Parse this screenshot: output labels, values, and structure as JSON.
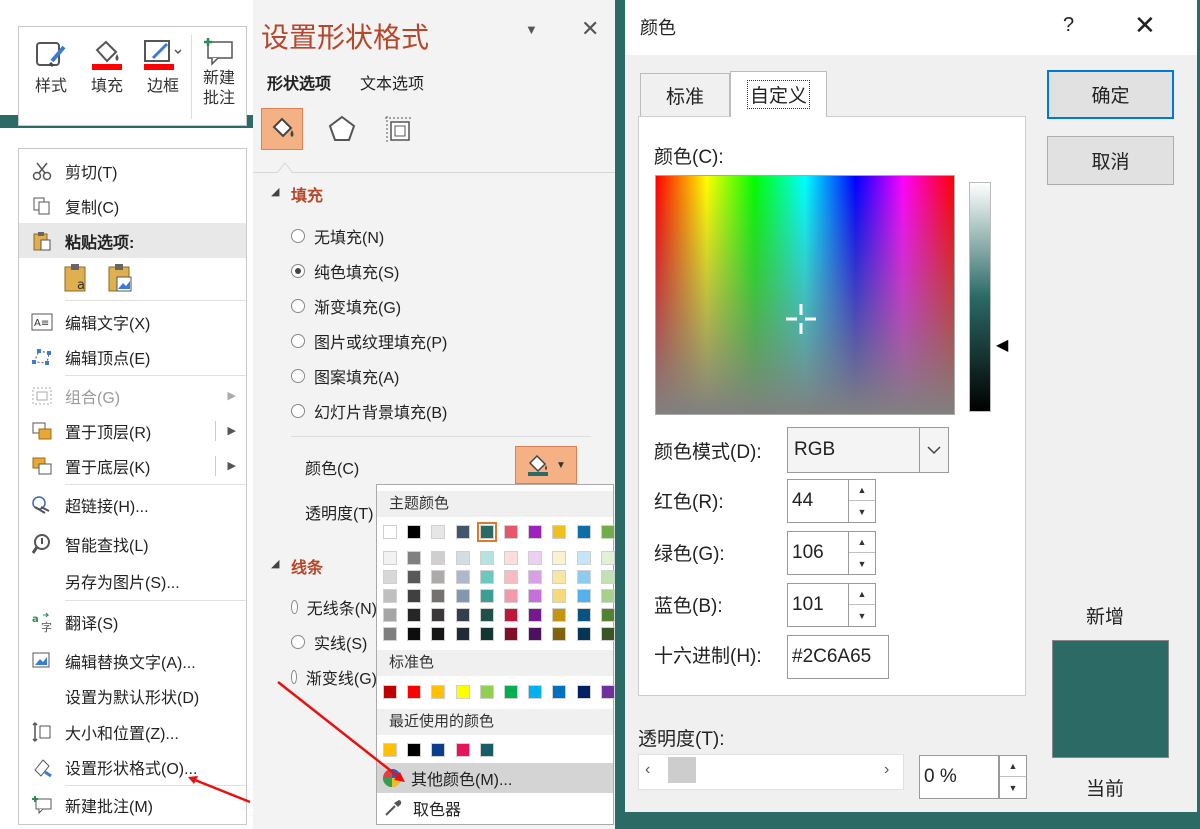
{
  "mini_toolbar": {
    "buttons": [
      {
        "label": "样式"
      },
      {
        "label": "填充"
      },
      {
        "label": "边框"
      },
      {
        "label": "新建\n批注"
      }
    ]
  },
  "context_menu": {
    "items": [
      {
        "label": "剪切(T)",
        "icon": "scissors-icon"
      },
      {
        "label": "复制(C)",
        "icon": "copy-icon"
      },
      {
        "label": "粘贴选项:",
        "icon": "paste-icon"
      },
      {
        "label": "编辑文字(X)",
        "icon": "edit-text-icon"
      },
      {
        "label": "编辑顶点(E)",
        "icon": "edit-points-icon"
      },
      {
        "label": "组合(G)",
        "icon": "group-icon"
      },
      {
        "label": "置于顶层(R)",
        "icon": "bring-front-icon"
      },
      {
        "label": "置于底层(K)",
        "icon": "send-back-icon"
      },
      {
        "label": "超链接(H)...",
        "icon": "link-icon"
      },
      {
        "label": "智能查找(L)",
        "icon": "smart-lookup-icon"
      },
      {
        "label": "另存为图片(S)...",
        "icon": ""
      },
      {
        "label": "翻译(S)",
        "icon": "translate-icon"
      },
      {
        "label": "编辑替换文字(A)...",
        "icon": "alt-text-icon"
      },
      {
        "label": "设置为默认形状(D)",
        "icon": ""
      },
      {
        "label": "大小和位置(Z)...",
        "icon": "size-position-icon"
      },
      {
        "label": "设置形状格式(O)...",
        "icon": "format-shape-icon"
      },
      {
        "label": "新建批注(M)",
        "icon": "comment-icon"
      }
    ]
  },
  "format_pane": {
    "title": "设置形状格式",
    "tabs": [
      "形状选项",
      "文本选项"
    ],
    "fill_section": "填充",
    "fill_options": [
      "无填充(N)",
      "纯色填充(S)",
      "渐变填充(G)",
      "图片或纹理填充(P)",
      "图案填充(A)",
      "幻灯片背景填充(B)"
    ],
    "selected_fill": 1,
    "color_label": "颜色(C)",
    "transparency_label": "透明度(T)",
    "line_section": "线条",
    "line_options": [
      "无线条(N)",
      "实线(S)",
      "渐变线(G)"
    ]
  },
  "color_popup": {
    "theme_header": "主题颜色",
    "standard_header": "标准色",
    "recent_header": "最近使用的颜色",
    "more_colors": "其他颜色(M)...",
    "eyedropper": "取色器",
    "theme_top": [
      "#ffffff",
      "#000000",
      "#e7e6e6",
      "#44546a",
      "#2c6a65",
      "#e8566c",
      "#a020c0",
      "#f2c01e",
      "#0e6fa8",
      "#70ad47"
    ],
    "theme_shades": [
      [
        "#f2f2f2",
        "#d8d8d8",
        "#bfbfbf",
        "#a5a5a5",
        "#7f7f7f"
      ],
      [
        "#808080",
        "#595959",
        "#404040",
        "#262626",
        "#0d0d0d"
      ],
      [
        "#d0cece",
        "#aeaaaa",
        "#757171",
        "#3a3838",
        "#171616"
      ],
      [
        "#d6dce4",
        "#adb9ca",
        "#8497b0",
        "#333f4f",
        "#222a35"
      ],
      [
        "#b5e3de",
        "#6cc7bd",
        "#3aa095",
        "#215049",
        "#163531"
      ],
      [
        "#fbdde2",
        "#f7bbc4",
        "#f399a7",
        "#c0163a",
        "#800f27"
      ],
      [
        "#eccff3",
        "#d9a0e7",
        "#c670db",
        "#781890",
        "#501060"
      ],
      [
        "#fcf2d1",
        "#f9e5a4",
        "#f7d977",
        "#c39510",
        "#82630b"
      ],
      [
        "#c6e5f8",
        "#8dcbf1",
        "#55b1ea",
        "#0a5280",
        "#073655"
      ],
      [
        "#e2efd9",
        "#c5e0b3",
        "#a8d08d",
        "#538135",
        "#375623"
      ]
    ],
    "standard": [
      "#c00000",
      "#ff0000",
      "#ffc000",
      "#ffff00",
      "#92d050",
      "#00b050",
      "#00b0f0",
      "#0070c0",
      "#002060",
      "#7030a0"
    ],
    "recent": [
      "#ffc000",
      "#000000",
      "#0a3e8c",
      "#e8155a",
      "#185c6a"
    ]
  },
  "color_dialog": {
    "title": "颜色",
    "help": "?",
    "tabs": [
      "标准",
      "自定义"
    ],
    "active_tab": 1,
    "colors_label": "颜色(C):",
    "mode_label": "颜色模式(D):",
    "mode": "RGB",
    "red_label": "红色(R):",
    "red": "44",
    "green_label": "绿色(G):",
    "green": "106",
    "blue_label": "蓝色(B):",
    "blue": "101",
    "hex_label": "十六进制(H):",
    "hex": "#2C6A65",
    "transparency_label": "透明度(T):",
    "transparency": "0 %",
    "ok": "确定",
    "cancel": "取消",
    "new_label": "新增",
    "current_label": "当前",
    "new_color": "#2c6a65",
    "current_color": "#2c6a65"
  }
}
